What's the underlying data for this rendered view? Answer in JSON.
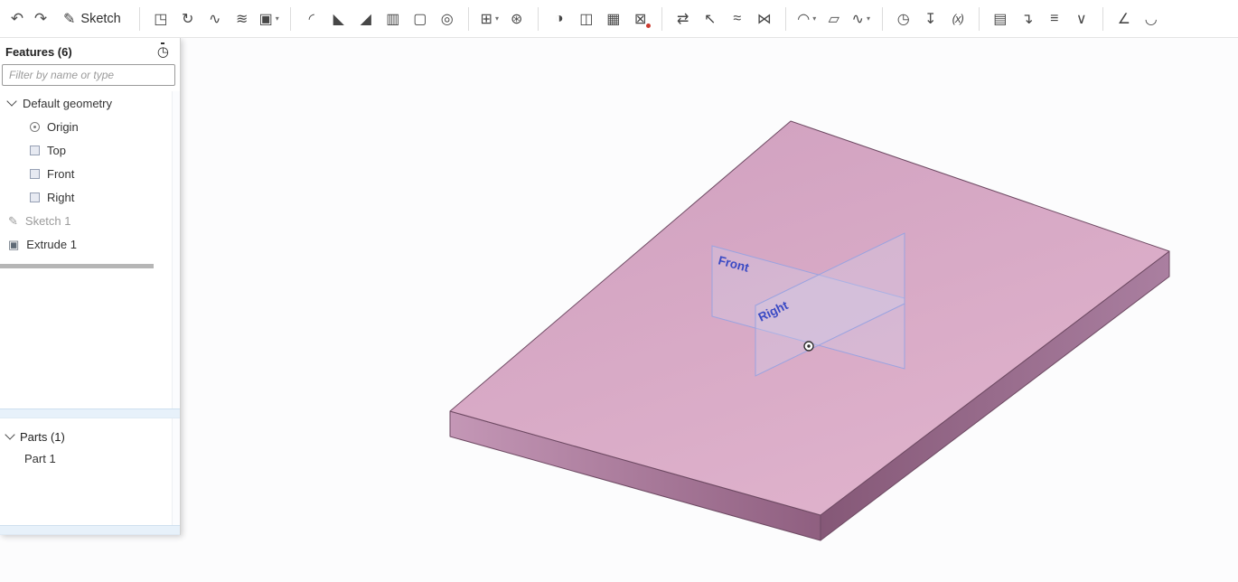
{
  "toolbar": {
    "undo_glyph": "↶",
    "redo_glyph": "↷",
    "sketch": {
      "label": "Sketch",
      "icon_glyph": "✎"
    },
    "dropdown_chevron": "▾",
    "items": [
      {
        "name": "extrude",
        "glyph": "◳"
      },
      {
        "name": "revolve",
        "glyph": "↻"
      },
      {
        "name": "sweep",
        "glyph": "∿"
      },
      {
        "name": "loft",
        "glyph": "≋"
      },
      {
        "name": "thicken",
        "glyph": "▣",
        "dropdown": true
      },
      {
        "divider": true
      },
      {
        "name": "fillet",
        "glyph": "◜"
      },
      {
        "name": "chamfer",
        "glyph": "◣"
      },
      {
        "name": "draft",
        "glyph": "◢"
      },
      {
        "name": "rib",
        "glyph": "▥"
      },
      {
        "name": "shell",
        "glyph": "▢"
      },
      {
        "name": "hole",
        "glyph": "◎"
      },
      {
        "divider": true
      },
      {
        "name": "linear-pattern",
        "glyph": "⊞",
        "dropdown": true
      },
      {
        "name": "circular-pattern",
        "glyph": "⊛"
      },
      {
        "divider": true
      },
      {
        "name": "boolean",
        "glyph": "◑"
      },
      {
        "name": "split",
        "glyph": "◫"
      },
      {
        "name": "enclose",
        "glyph": "▦"
      },
      {
        "name": "delete-part",
        "glyph": "⊠",
        "accent_dot": true
      },
      {
        "divider": true
      },
      {
        "name": "transform",
        "glyph": "⇄"
      },
      {
        "name": "move-face",
        "glyph": "↖"
      },
      {
        "name": "offset-surface",
        "glyph": "≈"
      },
      {
        "name": "mirror",
        "glyph": "⋈"
      },
      {
        "divider": true
      },
      {
        "name": "surface",
        "glyph": "◠",
        "dropdown": true
      },
      {
        "name": "plane",
        "glyph": "▱"
      },
      {
        "name": "curve",
        "glyph": "∿",
        "dropdown": true
      },
      {
        "divider": true
      },
      {
        "name": "history",
        "glyph": "◷"
      },
      {
        "name": "import",
        "glyph": "↧"
      },
      {
        "name": "variable",
        "glyph": "(x)"
      },
      {
        "divider": true
      },
      {
        "name": "custom-features",
        "glyph": "▤"
      },
      {
        "name": "derived",
        "glyph": "↴"
      },
      {
        "name": "configurations",
        "glyph": "≡"
      },
      {
        "name": "appearance",
        "glyph": "∨"
      },
      {
        "divider": true
      },
      {
        "name": "measure",
        "glyph": "∠"
      },
      {
        "name": "section-view",
        "glyph": "◡"
      }
    ]
  },
  "icons": {
    "pencil": "✎",
    "stopwatch": "◷",
    "extrude_feature": "▣"
  },
  "features_panel": {
    "title": "Features (6)",
    "filter_placeholder": "Filter by name or type",
    "default_geometry": {
      "label": "Default geometry",
      "children": [
        "Origin",
        "Top",
        "Front",
        "Right"
      ]
    },
    "features": [
      {
        "label": "Sketch 1"
      },
      {
        "label": "Extrude 1"
      }
    ]
  },
  "parts_panel": {
    "title": "Parts (1)",
    "items": [
      {
        "label": "Part 1"
      }
    ]
  },
  "viewport": {
    "plane_labels": {
      "front": "Front",
      "right": "Right"
    },
    "colors": {
      "plate_top_light": "#dfb2cc",
      "plate_top_dark": "#cf9fbe",
      "plate_front_light": "#c497b6",
      "plate_front_dark": "#8f5f80",
      "plate_side_light": "#aa7fa0",
      "plate_side_dark": "#855877",
      "edge": "#6e4a63",
      "plane_stroke": "#9aa3e0",
      "plane_label": "#3a4ac4",
      "canvas": "#fcfcfd"
    }
  }
}
